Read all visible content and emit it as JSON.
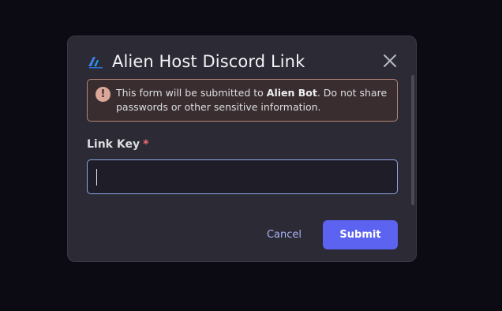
{
  "modal": {
    "title": "Alien Host Discord Link",
    "logo_icon": "alien-host-logo-icon",
    "close_icon": "close-icon"
  },
  "notice": {
    "icon": "exclamation-icon",
    "text_before": "This form will be submitted to ",
    "bot_name": "Alien Bot",
    "text_after": ". Do not share passwords or other sensitive information."
  },
  "form": {
    "field_label": "Link Key",
    "required_marker": "*",
    "input_value": "",
    "input_placeholder": ""
  },
  "actions": {
    "cancel_label": "Cancel",
    "submit_label": "Submit"
  },
  "colors": {
    "accent": "#5b63f0",
    "cancel_link": "#a9b4f6",
    "required": "#f06b73",
    "notice_border": "#b38476",
    "input_focus_border": "#8ea6e6"
  }
}
